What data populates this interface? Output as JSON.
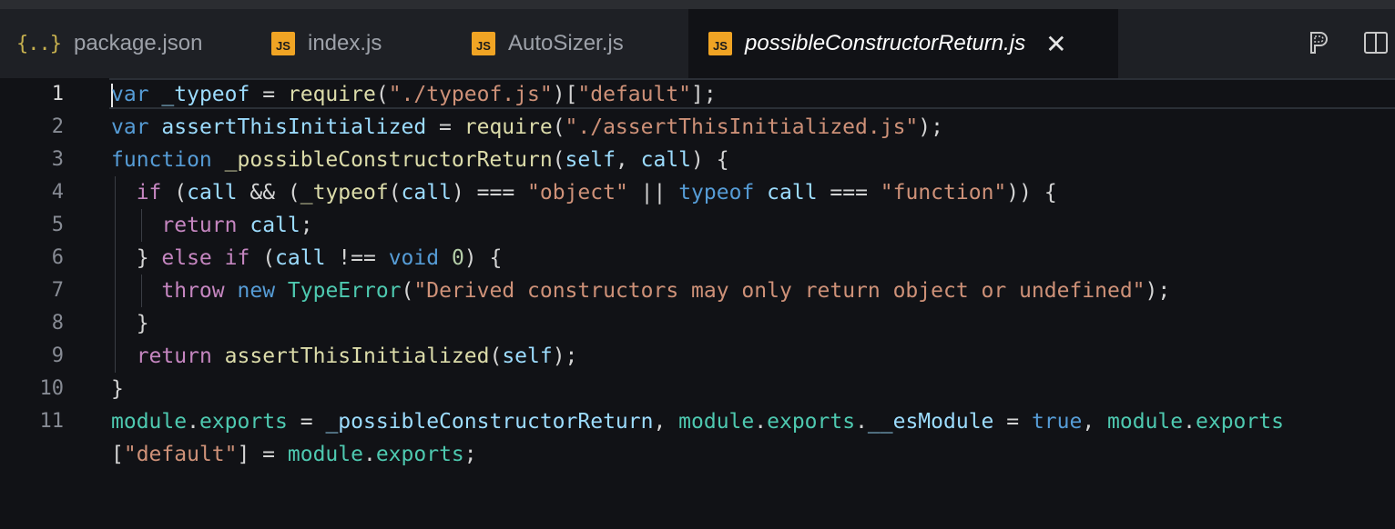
{
  "tabs": [
    {
      "icon": "{..}",
      "label": "package.json",
      "active": false
    },
    {
      "icon": "JS",
      "label": "index.js",
      "active": false
    },
    {
      "icon": "JS",
      "label": "AutoSizer.js",
      "active": false
    },
    {
      "icon": "JS",
      "label": "possibleConstructorReturn.js",
      "active": true,
      "close": "✕"
    }
  ],
  "editor": {
    "line_numbers": [
      "1",
      "2",
      "3",
      "4",
      "5",
      "6",
      "7",
      "8",
      "9",
      "10",
      "11"
    ],
    "lines": [
      [
        [
          "k",
          "var"
        ],
        [
          "p",
          " "
        ],
        [
          "v",
          "_typeof"
        ],
        [
          "p",
          " = "
        ],
        [
          "f",
          "require"
        ],
        [
          "p",
          "("
        ],
        [
          "s",
          "\"./typeof.js\""
        ],
        [
          "p",
          ")["
        ],
        [
          "s",
          "\"default\""
        ],
        [
          "p",
          "];"
        ]
      ],
      [
        [
          "k",
          "var"
        ],
        [
          "p",
          " "
        ],
        [
          "v",
          "assertThisInitialized"
        ],
        [
          "p",
          " = "
        ],
        [
          "f",
          "require"
        ],
        [
          "p",
          "("
        ],
        [
          "s",
          "\"./assertThisInitialized.js\""
        ],
        [
          "p",
          ");"
        ]
      ],
      [
        [
          "k",
          "function"
        ],
        [
          "p",
          " "
        ],
        [
          "f",
          "_possibleConstructorReturn"
        ],
        [
          "p",
          "("
        ],
        [
          "v",
          "self"
        ],
        [
          "p",
          ", "
        ],
        [
          "v",
          "call"
        ],
        [
          "p",
          ") {"
        ]
      ],
      [
        [
          "p",
          "  "
        ],
        [
          "kc",
          "if"
        ],
        [
          "p",
          " ("
        ],
        [
          "v",
          "call"
        ],
        [
          "p",
          " && ("
        ],
        [
          "f",
          "_typeof"
        ],
        [
          "p",
          "("
        ],
        [
          "v",
          "call"
        ],
        [
          "p",
          ") === "
        ],
        [
          "s",
          "\"object\""
        ],
        [
          "p",
          " || "
        ],
        [
          "k",
          "typeof"
        ],
        [
          "p",
          " "
        ],
        [
          "v",
          "call"
        ],
        [
          "p",
          " === "
        ],
        [
          "s",
          "\"function\""
        ],
        [
          "p",
          ")) {"
        ]
      ],
      [
        [
          "p",
          "    "
        ],
        [
          "kc",
          "return"
        ],
        [
          "p",
          " "
        ],
        [
          "v",
          "call"
        ],
        [
          "p",
          ";"
        ]
      ],
      [
        [
          "p",
          "  } "
        ],
        [
          "kc",
          "else"
        ],
        [
          "p",
          " "
        ],
        [
          "kc",
          "if"
        ],
        [
          "p",
          " ("
        ],
        [
          "v",
          "call"
        ],
        [
          "p",
          " !== "
        ],
        [
          "k",
          "void"
        ],
        [
          "p",
          " "
        ],
        [
          "n",
          "0"
        ],
        [
          "p",
          ") {"
        ]
      ],
      [
        [
          "p",
          "    "
        ],
        [
          "kc",
          "throw"
        ],
        [
          "p",
          " "
        ],
        [
          "k",
          "new"
        ],
        [
          "p",
          " "
        ],
        [
          "t",
          "TypeError"
        ],
        [
          "p",
          "("
        ],
        [
          "s",
          "\"Derived constructors may only return object or undefined\""
        ],
        [
          "p",
          ");"
        ]
      ],
      [
        [
          "p",
          "  }"
        ]
      ],
      [
        [
          "p",
          "  "
        ],
        [
          "kc",
          "return"
        ],
        [
          "p",
          " "
        ],
        [
          "f",
          "assertThisInitialized"
        ],
        [
          "p",
          "("
        ],
        [
          "v",
          "self"
        ],
        [
          "p",
          ");"
        ]
      ],
      [
        [
          "p",
          "}"
        ]
      ],
      [
        [
          "t",
          "module"
        ],
        [
          "p",
          "."
        ],
        [
          "t",
          "exports"
        ],
        [
          "p",
          " = "
        ],
        [
          "v",
          "_possibleConstructorReturn"
        ],
        [
          "p",
          ", "
        ],
        [
          "t",
          "module"
        ],
        [
          "p",
          "."
        ],
        [
          "t",
          "exports"
        ],
        [
          "p",
          "."
        ],
        [
          "v",
          "__esModule"
        ],
        [
          "p",
          " = "
        ],
        [
          "k",
          "true"
        ],
        [
          "p",
          ", "
        ],
        [
          "t",
          "module"
        ],
        [
          "p",
          "."
        ],
        [
          "t",
          "exports"
        ]
      ],
      [
        [
          "p",
          "["
        ],
        [
          "s",
          "\"default\""
        ],
        [
          "p",
          "] = "
        ],
        [
          "t",
          "module"
        ],
        [
          "p",
          "."
        ],
        [
          "t",
          "exports"
        ],
        [
          "p",
          ";"
        ]
      ]
    ]
  },
  "toolbar": {
    "preview_icon": "open-preview-icon",
    "split_icon": "split-editor-icon"
  },
  "colors": {
    "keyword": "#569cd6",
    "control": "#c586c0",
    "variable": "#9cdcfe",
    "function": "#dcdcaa",
    "string": "#ce9178",
    "type": "#4ec9b0",
    "number": "#b5cea8",
    "js_icon": "#f0a424"
  }
}
